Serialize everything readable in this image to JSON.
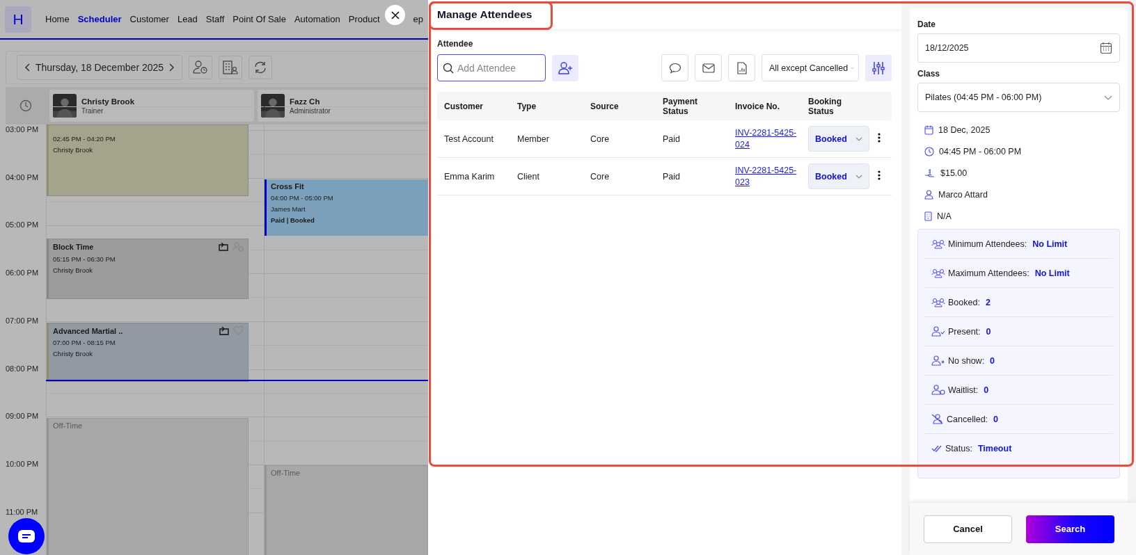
{
  "nav": {
    "logo": "H",
    "items": [
      {
        "label": "Home",
        "selected": false
      },
      {
        "label": "Scheduler",
        "selected": true
      },
      {
        "label": "Customer",
        "selected": false
      },
      {
        "label": "Lead",
        "selected": false
      },
      {
        "label": "Staff",
        "selected": false
      },
      {
        "label": "Point Of Sale",
        "selected": false
      },
      {
        "label": "Automation",
        "selected": false
      },
      {
        "label": "Product",
        "selected": false
      },
      {
        "label": "ep",
        "selected": false
      }
    ]
  },
  "scheduler": {
    "date": "Thursday, 18 December 2025",
    "hours": [
      "03:00 PM",
      "04:00 PM",
      "05:00 PM",
      "06:00 PM",
      "07:00 PM",
      "08:00 PM",
      "09:00 PM",
      "10:00 PM",
      "11:00 PM"
    ],
    "staff": [
      {
        "name": "Christy Brook",
        "role": "Trainer",
        "events": [
          {
            "kind": "class",
            "color": "#a4a48c",
            "time": "02:45 PM - 04:20 PM",
            "person": "Christy Brook"
          },
          {
            "kind": "block",
            "color": "#9c9c9c",
            "title": "Block Time",
            "time": "05:15 PM - 06:30 PM",
            "person": "Christy Brook"
          },
          {
            "kind": "class",
            "color": "#9199a3",
            "title": "Advanced Martial ..",
            "time": "07:00 PM - 08:15 PM",
            "person": "Christy Brook"
          },
          {
            "kind": "off",
            "title": "Off-Time"
          }
        ]
      },
      {
        "name": "Fazz Ch",
        "role": "Administrator",
        "events": [
          {
            "kind": "class",
            "color": "#7aa0bb",
            "title": "Cross Fit",
            "time": "04:00 PM - 05:00 PM",
            "person": "James Mart",
            "status": "Paid | Booked"
          },
          {
            "kind": "off",
            "title": "Off-Time"
          }
        ]
      }
    ]
  },
  "dialog": {
    "title": "Manage Attendees",
    "attendee_label": "Attendee",
    "search_placeholder": "Add Attendee",
    "filter": "All except Cancelled",
    "columns": [
      "Customer",
      "Type",
      "Source",
      "Payment Status",
      "Invoice No.",
      "Booking Status"
    ],
    "rows": [
      {
        "customer": "Test Account",
        "type": "Member",
        "source": "Core",
        "payment": "Paid",
        "invoice": "INV-2281-5425-024",
        "booking": "Booked"
      },
      {
        "customer": "Emma Karim",
        "type": "Client",
        "source": "Core",
        "payment": "Paid",
        "invoice": "INV-2281-5425-023",
        "booking": "Booked"
      }
    ]
  },
  "details": {
    "date_label": "Date",
    "date": "18/12/2025",
    "class_label": "Class",
    "class": "Pilates (04:45 PM - 06:00 PM)",
    "info": [
      {
        "kind": "date",
        "text": "18 Dec, 2025"
      },
      {
        "kind": "time",
        "text": "04:45 PM - 06:00 PM"
      },
      {
        "kind": "price",
        "text": "$15.00"
      },
      {
        "kind": "person",
        "text": "Marco Attard"
      },
      {
        "kind": "room",
        "text": "N/A"
      }
    ],
    "stats": [
      {
        "kind": "min",
        "label": "Minimum Attendees:",
        "value": "No Limit"
      },
      {
        "kind": "max",
        "label": "Maximum Attendees:",
        "value": "No Limit"
      },
      {
        "kind": "booked",
        "label": "Booked:",
        "value": "2"
      },
      {
        "kind": "present",
        "label": "Present:",
        "value": "0"
      },
      {
        "kind": "noshow",
        "label": "No show:",
        "value": "0"
      },
      {
        "kind": "waitlist",
        "label": "Waitlist:",
        "value": "0"
      },
      {
        "kind": "cancelled",
        "label": "Cancelled:",
        "value": "0"
      },
      {
        "kind": "status",
        "label": "Status:",
        "value": "Timeout"
      }
    ],
    "cancel": "Cancel",
    "search": "Search"
  }
}
